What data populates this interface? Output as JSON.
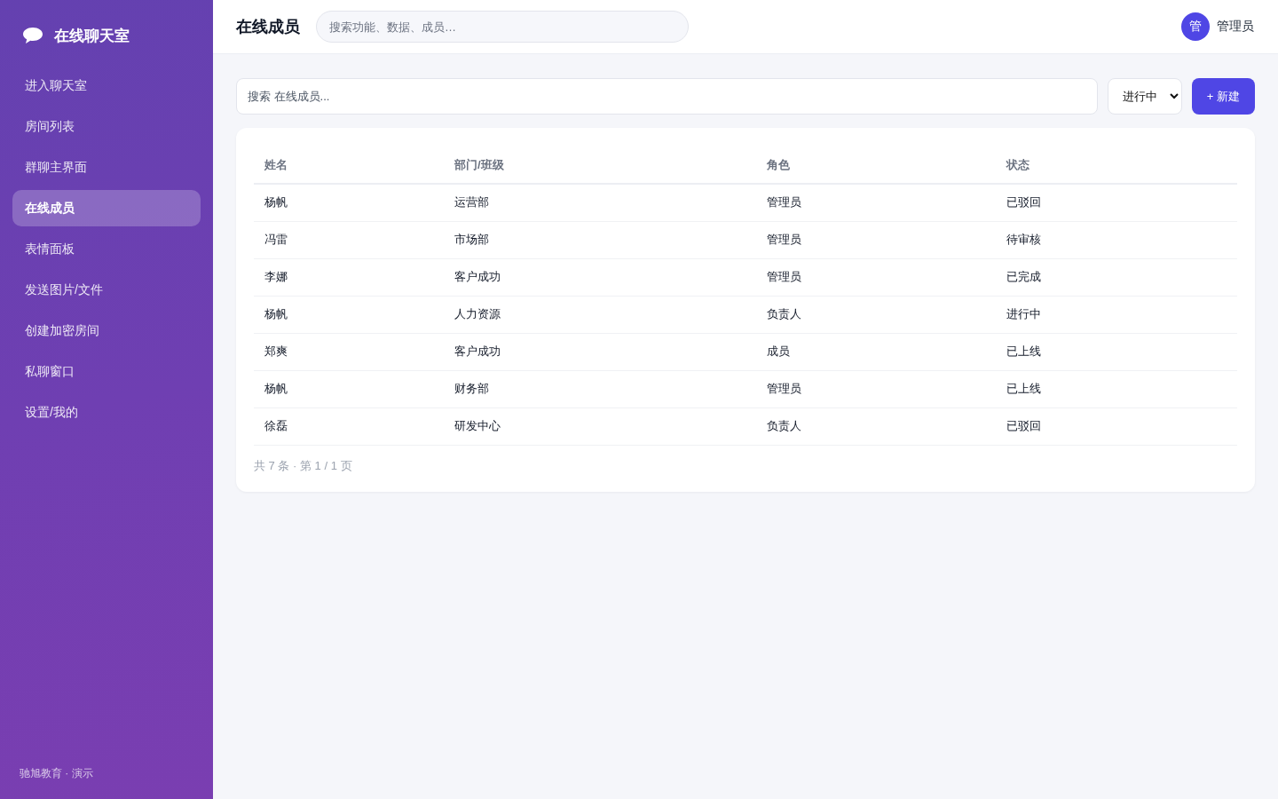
{
  "sidebar": {
    "brand": "在线聊天室",
    "items": [
      {
        "label": "进入聊天室",
        "selected": false
      },
      {
        "label": "房间列表",
        "selected": false
      },
      {
        "label": "群聊主界面",
        "selected": false
      },
      {
        "label": "在线成员",
        "selected": true
      },
      {
        "label": "表情面板",
        "selected": false
      },
      {
        "label": "发送图片/文件",
        "selected": false
      },
      {
        "label": "创建加密房间",
        "selected": false
      },
      {
        "label": "私聊窗口",
        "selected": false
      },
      {
        "label": "设置/我的",
        "selected": false
      }
    ],
    "footer": "驰旭教育 · 演示"
  },
  "header": {
    "title": "在线成员",
    "search": {
      "placeholder": "搜索功能、数据、成员…"
    },
    "user": {
      "avatar": "管",
      "name": "管理员"
    }
  },
  "toolbar": {
    "search": {
      "placeholder": "搜索 在线成员..."
    },
    "filter": {
      "value": "进行中"
    },
    "new_button": "+ 新建"
  },
  "table": {
    "columns": [
      "姓名",
      "部门/班级",
      "角色",
      "状态"
    ],
    "rows": [
      [
        "杨帆",
        "运营部",
        "管理员",
        "已驳回"
      ],
      [
        "冯雷",
        "市场部",
        "管理员",
        "待审核"
      ],
      [
        "李娜",
        "客户成功",
        "管理员",
        "已完成"
      ],
      [
        "杨帆",
        "人力资源",
        "负责人",
        "进行中"
      ],
      [
        "郑爽",
        "客户成功",
        "成员",
        "已上线"
      ],
      [
        "杨帆",
        "财务部",
        "管理员",
        "已上线"
      ],
      [
        "徐磊",
        "研发中心",
        "负责人",
        "已驳回"
      ]
    ]
  },
  "pagination": "共 7 条 · 第 1 / 1 页"
}
